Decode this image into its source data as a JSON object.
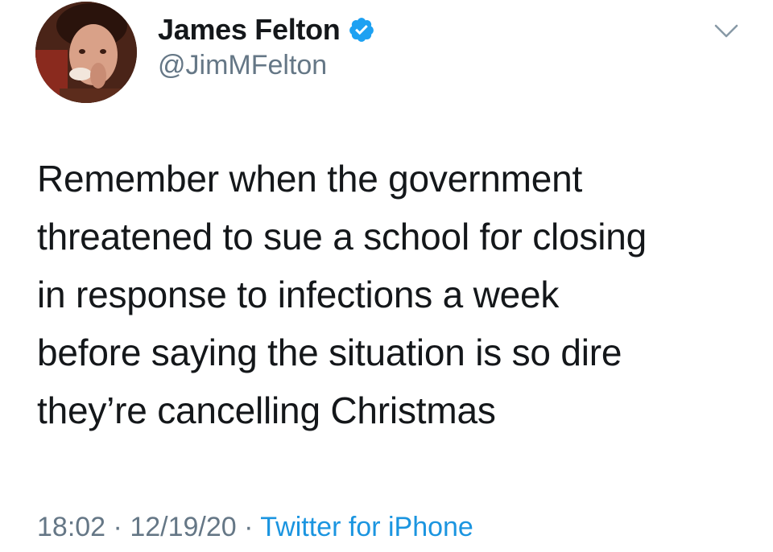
{
  "author": {
    "display_name": "James Felton",
    "handle": "@JimMFelton",
    "verified": true,
    "avatar_icon": "profile-photo"
  },
  "tweet": {
    "lines": [
      "Remember when the government",
      "threatened to sue a school for closing",
      "in response to infections a week",
      "before saying the situation is so dire",
      "they’re cancelling Christmas"
    ]
  },
  "meta": {
    "time": "18:02",
    "separator": " · ",
    "date": "12/19/20",
    "source": "Twitter for iPhone"
  },
  "colors": {
    "text": "#14171a",
    "secondary": "#657786",
    "link": "#1b95e0",
    "verified": "#1da1f2"
  },
  "icons": {
    "verified": "verified-badge-icon",
    "menu": "chevron-down-icon"
  }
}
